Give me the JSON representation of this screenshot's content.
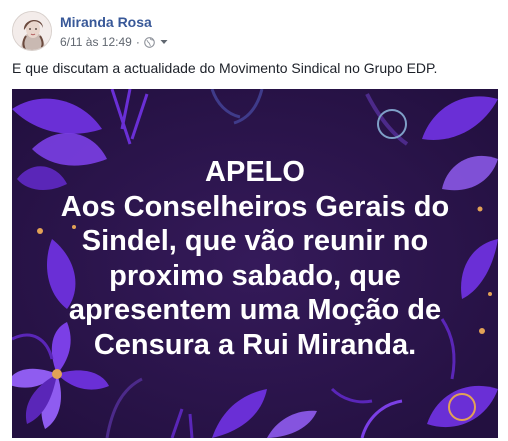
{
  "post": {
    "author": "Miranda Rosa",
    "timestamp": "6/11 às 12:49",
    "separator": "·",
    "privacy_icon": "globe-icon",
    "menu_icon": "chevron-down-icon",
    "text": "E que discutam a actualidade do Movimento Sindical no Grupo EDP."
  },
  "image": {
    "lines": [
      "APELO",
      "Aos Conselheiros Gerais do",
      "Sindel, que vão reunir no",
      "proximo sabado, que",
      "apresentem uma Moção de",
      "Censura a Rui Miranda."
    ],
    "colors": {
      "background": "#2b1448",
      "leaf_purple": "#6a2fd6",
      "leaf_light": "#8f5cf0",
      "accent_gold": "#e2a256",
      "text": "#ffffff"
    }
  }
}
